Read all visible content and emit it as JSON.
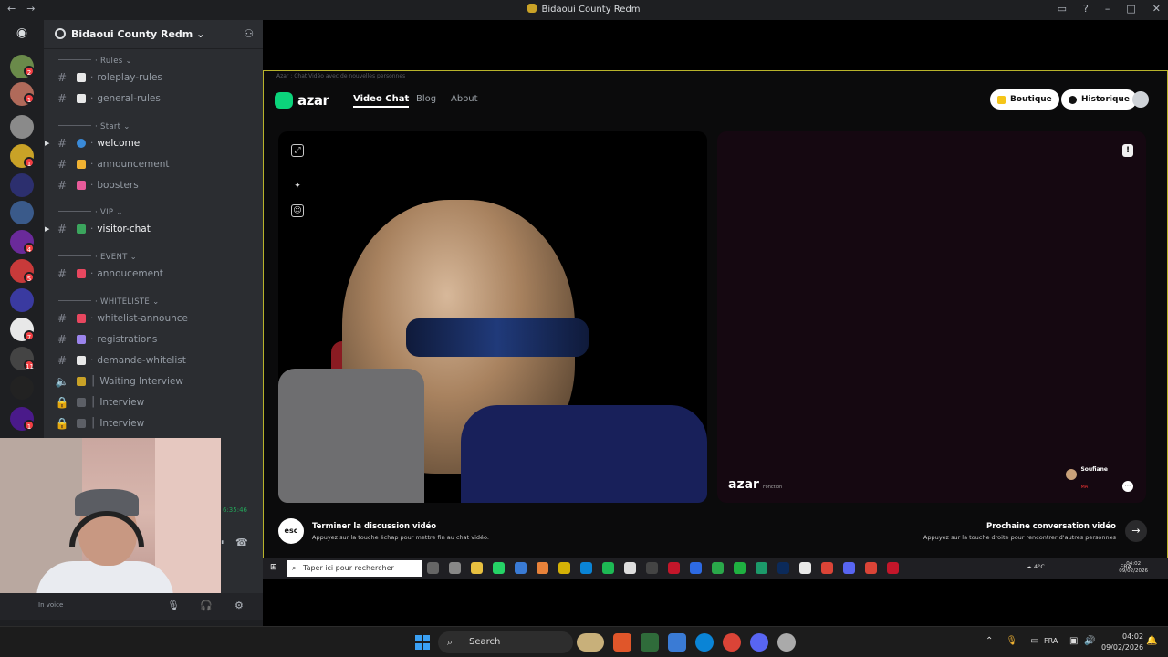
{
  "titlebar": {
    "title": "Bidaoui County Redm",
    "back": "←",
    "forward": "→"
  },
  "server": {
    "name": "Bidaoui County Redm",
    "chevron": "⌄"
  },
  "server_badges": [
    "2",
    "1",
    "1",
    "4",
    "5",
    "7",
    "11",
    "1"
  ],
  "categories": {
    "rules": "Rules",
    "start": "Start",
    "vip": "VIP",
    "event": "EVENT",
    "whiteliste": "WHITELISTE"
  },
  "channels": {
    "roleplay_rules": "roleplay-rules",
    "general_rules": "general-rules",
    "welcome": "welcome",
    "announcement": "announcement",
    "boosters": "boosters",
    "visitor_chat": "visitor-chat",
    "annoucement": "annoucement",
    "whitelist_announce": "whitelist-announce",
    "registrations": "registrations",
    "demande_whitelist": "demande-whitelist",
    "waiting_interview": "Waiting Interview",
    "interview_1": "Interview",
    "interview_2": "Interview"
  },
  "voice": {
    "timer": "6:35:46",
    "status": "In voice"
  },
  "azar": {
    "window_title": "Azar : Chat Vidéo avec de nouvelles personnes",
    "logo": "azar",
    "nav": {
      "video_chat": "Video Chat",
      "blog": "Blog",
      "about": "About"
    },
    "boutique": "Boutique",
    "historique": "Historique",
    "watermark": "azar",
    "watermark_sub": "Fonction",
    "peer_name": "Soufiane",
    "peer_country": "MA",
    "end_title": "Terminer la discussion vidéo",
    "end_sub": "Appuyez sur la touche échap pour mettre fin au chat vidéo.",
    "esc_label": "esc",
    "next_title": "Prochaine conversation vidéo",
    "next_sub": "Appuyez sur la touche droite pour rencontrer d'autres personnes"
  },
  "inner_taskbar": {
    "search_placeholder": "Taper ici pour rechercher",
    "weather": "4°C",
    "lang": "FRA",
    "time": "04:02",
    "date": "09/02/2026"
  },
  "taskbar": {
    "search": "Search",
    "lang": "FRA",
    "time": "04:02",
    "date": "09/02/2026"
  },
  "colors": {
    "azar_green": "#0bd47b",
    "discord_bg": "#2b2d31",
    "badge_red": "#f23f43",
    "window_border": "#b8b32b"
  }
}
